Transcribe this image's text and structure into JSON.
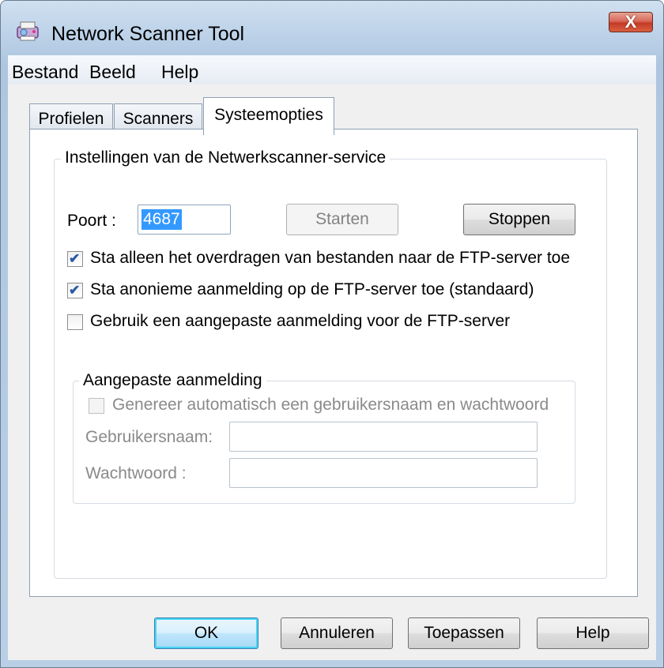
{
  "window": {
    "title": "Network Scanner Tool",
    "close_label": "X"
  },
  "menu": {
    "items": [
      "Bestand",
      "Beeld",
      "Help"
    ]
  },
  "tabs": [
    "Profielen",
    "Scanners",
    "Systeemopties"
  ],
  "service_group": {
    "title": "Instellingen van de Netwerkscanner-service",
    "port_label": "Poort :",
    "port_value": "4687",
    "start_button": "Starten",
    "stop_button": "Stoppen",
    "options": [
      {
        "label": "Sta alleen het overdragen van bestanden naar de FTP-server toe",
        "checked": true
      },
      {
        "label": "Sta anonieme aanmelding op de FTP-server toe (standaard)",
        "checked": true
      },
      {
        "label": "Gebruik een aangepaste aanmelding voor de FTP-server",
        "checked": false
      }
    ]
  },
  "custom_login": {
    "title": "Aangepaste aanmelding",
    "auto_generate_label": "Genereer automatisch een gebruikersnaam en wachtwoord",
    "username_label": "Gebruikersnaam:",
    "password_label": "Wachtwoord :",
    "username_value": "",
    "password_value": ""
  },
  "footer": {
    "ok": "OK",
    "cancel": "Annuleren",
    "apply": "Toepassen",
    "help": "Help"
  },
  "colors": {
    "selection": "#3399ff",
    "close_button": "#c43b25",
    "default_button_glow": "#48d4f4"
  }
}
